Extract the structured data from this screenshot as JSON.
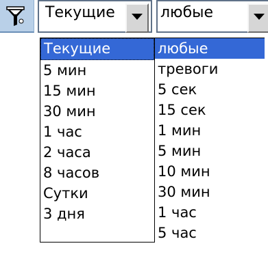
{
  "filter": {
    "icon": "filter-funnel-icon"
  },
  "period_combo": {
    "value": "Текущие"
  },
  "interval_combo": {
    "value": "любые"
  },
  "period_options": [
    {
      "label": "Текущие",
      "selected": true
    },
    {
      "label": "5 мин"
    },
    {
      "label": "15 мин"
    },
    {
      "label": "30 мин"
    },
    {
      "label": "1 час"
    },
    {
      "label": "2 часа"
    },
    {
      "label": "8 часов"
    },
    {
      "label": "Сутки"
    },
    {
      "label": "3 дня"
    }
  ],
  "interval_options": [
    {
      "label": "любые",
      "selected": true
    },
    {
      "label": "тревоги"
    },
    {
      "label": "5 сек"
    },
    {
      "label": "15 сек"
    },
    {
      "label": "1 мин"
    },
    {
      "label": "5 мин"
    },
    {
      "label": "10 мин"
    },
    {
      "label": "30 мин"
    },
    {
      "label": "1 час"
    },
    {
      "label": "5 час"
    }
  ],
  "colors": {
    "selection": "#3468d6",
    "toolbar": "#b9d0e8"
  }
}
